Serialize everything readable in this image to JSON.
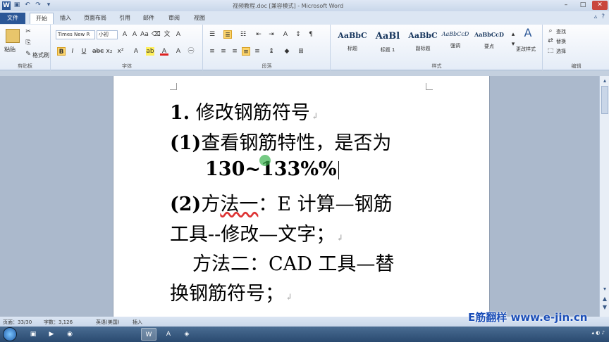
{
  "titlebar": {
    "app_icon": "W",
    "window_title": "视频教程.doc [兼容模式] - Microsoft Word",
    "qat_icons": [
      "save-icon",
      "undo-icon",
      "redo-icon",
      "customize-icon"
    ],
    "qat_glyphs": [
      "▣",
      "↶",
      "↷",
      "▾"
    ]
  },
  "tabs": [
    {
      "label": "文件"
    },
    {
      "label": "开始"
    },
    {
      "label": "插入"
    },
    {
      "label": "页面布局"
    },
    {
      "label": "引用"
    },
    {
      "label": "邮件"
    },
    {
      "label": "审阅"
    },
    {
      "label": "视图"
    }
  ],
  "ribbon": {
    "clipboard": {
      "paste": "粘贴",
      "format_painter": "格式刷",
      "label": "剪贴板"
    },
    "font": {
      "font_name": "Times New R",
      "font_size": "小初",
      "label": "字体"
    },
    "paragraph": {
      "label": "段落"
    },
    "styles": {
      "label": "样式",
      "items": [
        {
          "sample": "AaBbC",
          "name": "标题"
        },
        {
          "sample": "AaBl",
          "name": "标题 1"
        },
        {
          "sample": "AaBbC",
          "name": "副标题"
        },
        {
          "sample": "AaBbCcD",
          "name": "强调"
        },
        {
          "sample": "AaBbCcD",
          "name": "要点"
        }
      ],
      "change_styles": "更改样式"
    },
    "editing": {
      "find": "查找",
      "replace": "替换",
      "select": "选择",
      "label": "编辑"
    }
  },
  "document": {
    "lines": [
      {
        "bold_prefix": "1.",
        "text": " 修改钢筋符号"
      },
      {
        "bold_prefix": "(1)",
        "text": "查看钢筋特性，是否为"
      },
      {
        "bold_prefix": "",
        "text": "130~133%%"
      },
      {
        "bold_prefix": "(2)",
        "text": "方法一：E 计算—钢筋"
      },
      {
        "bold_prefix": "",
        "text": "工具--修改—文字；"
      },
      {
        "bold_prefix": "",
        "text": "方法二：CAD 工具—替"
      },
      {
        "bold_prefix": "",
        "text": "换钢筋符号；"
      }
    ],
    "underlined_word": "法一"
  },
  "statusbar": {
    "page": "页面：33/30",
    "words": "字数：3,126",
    "lang": "英语(美国)",
    "mode": "插入"
  },
  "watermark": "E筋翻样 www.e-jin.cn",
  "colors": {
    "accent": "#2b5797",
    "watermark": "#1c4fb8"
  }
}
